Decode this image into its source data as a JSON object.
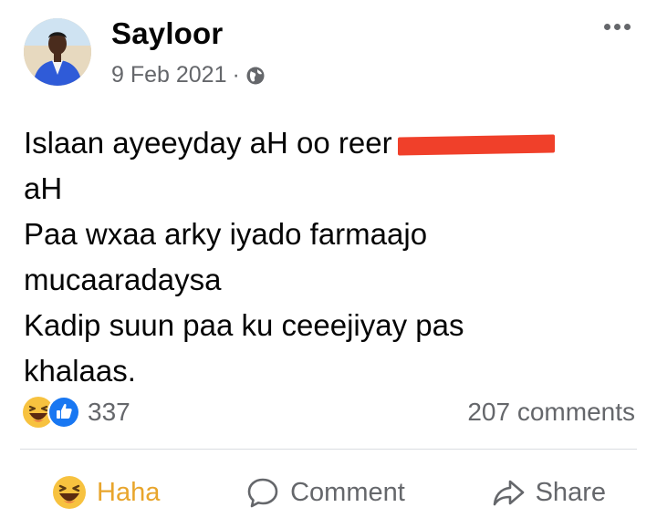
{
  "post": {
    "author": "Sayloor",
    "date": "9 Feb 2021",
    "separator": "·",
    "audience_icon": "globe-icon",
    "text_lines": [
      "Islaan ayeeyday aH oo reer",
      "aH",
      "Paa wxaa arky iyado farmaajo",
      "mucaaradaysa",
      "Kadip suun paa ku ceeejiyay pas",
      "khalaas."
    ]
  },
  "stats": {
    "reaction_icons": [
      "haha-reaction-icon",
      "like-reaction-icon"
    ],
    "reactions": "337",
    "comments": "207 comments"
  },
  "actions": {
    "haha": "Haha",
    "comment": "Comment",
    "share": "Share"
  },
  "colors": {
    "haha_accent": "#e8a52c",
    "like_blue": "#1877f2",
    "muted_text": "#65676b",
    "redaction": "#f0402a"
  }
}
